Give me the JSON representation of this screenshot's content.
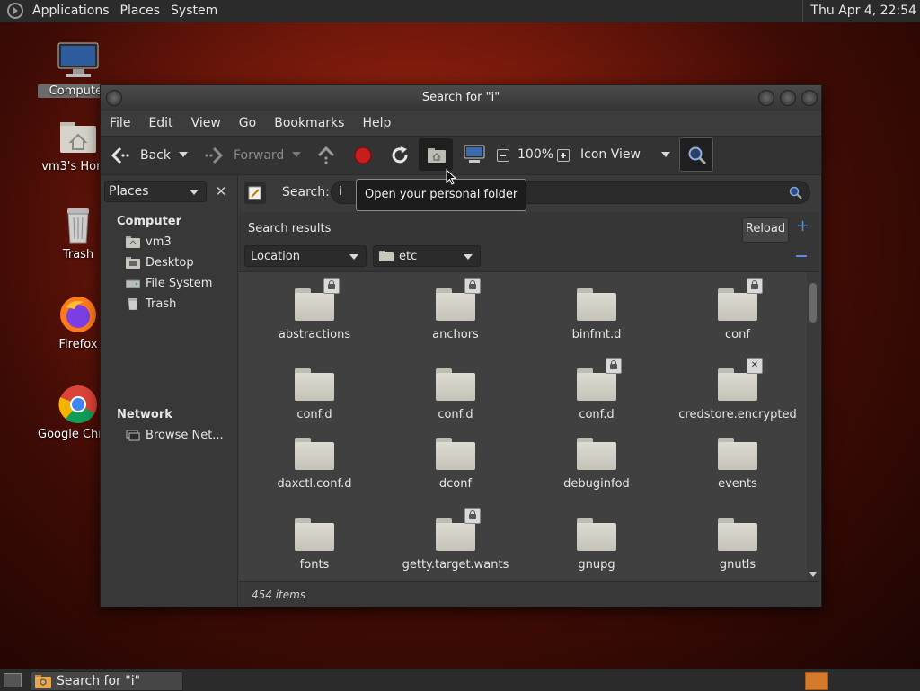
{
  "top_panel": {
    "menus": [
      "Applications",
      "Places",
      "System"
    ],
    "clock": "Thu Apr  4, 22:54"
  },
  "desktop": {
    "icons": [
      {
        "label": "Computer",
        "icon": "computer-icon"
      },
      {
        "label": "vm3's Home",
        "icon": "home-folder-icon"
      },
      {
        "label": "Trash",
        "icon": "trash-icon"
      },
      {
        "label": "Firefox",
        "icon": "firefox-icon"
      },
      {
        "label": "Google Chrome",
        "icon": "chrome-icon"
      }
    ]
  },
  "window": {
    "title": "Search for \"i\"",
    "menubar": [
      "File",
      "Edit",
      "View",
      "Go",
      "Bookmarks",
      "Help"
    ],
    "toolbar": {
      "back": "Back",
      "forward": "Forward",
      "zoom": "100%",
      "view_mode": "Icon View"
    },
    "sidebar": {
      "combo": "Places",
      "sections": [
        {
          "heading": "Computer",
          "items": [
            "vm3",
            "Desktop",
            "File System",
            "Trash"
          ]
        },
        {
          "heading": "Network",
          "items": [
            "Browse Net..."
          ]
        }
      ]
    },
    "search": {
      "label": "Search:",
      "value": "i"
    },
    "results": {
      "title": "Search results",
      "reload": "Reload",
      "criteria": "Location",
      "location_value": "etc"
    },
    "files": [
      {
        "name": "abstractions",
        "emblem": "lock"
      },
      {
        "name": "anchors",
        "emblem": "lock"
      },
      {
        "name": "binfmt.d",
        "emblem": ""
      },
      {
        "name": "conf",
        "emblem": "lock"
      },
      {
        "name": "conf.d",
        "emblem": ""
      },
      {
        "name": "conf.d",
        "emblem": ""
      },
      {
        "name": "conf.d",
        "emblem": "lock"
      },
      {
        "name": "credstore.encrypted",
        "emblem": "x"
      },
      {
        "name": "daxctl.conf.d",
        "emblem": ""
      },
      {
        "name": "dconf",
        "emblem": ""
      },
      {
        "name": "debuginfod",
        "emblem": ""
      },
      {
        "name": "events",
        "emblem": ""
      },
      {
        "name": "fonts",
        "emblem": ""
      },
      {
        "name": "getty.target.wants",
        "emblem": "lock"
      },
      {
        "name": "gnupg",
        "emblem": ""
      },
      {
        "name": "gnutls",
        "emblem": ""
      }
    ],
    "status": "454 items",
    "tooltip": "Open your personal folder"
  },
  "taskbar": {
    "window_button": "Search for \"i\""
  }
}
